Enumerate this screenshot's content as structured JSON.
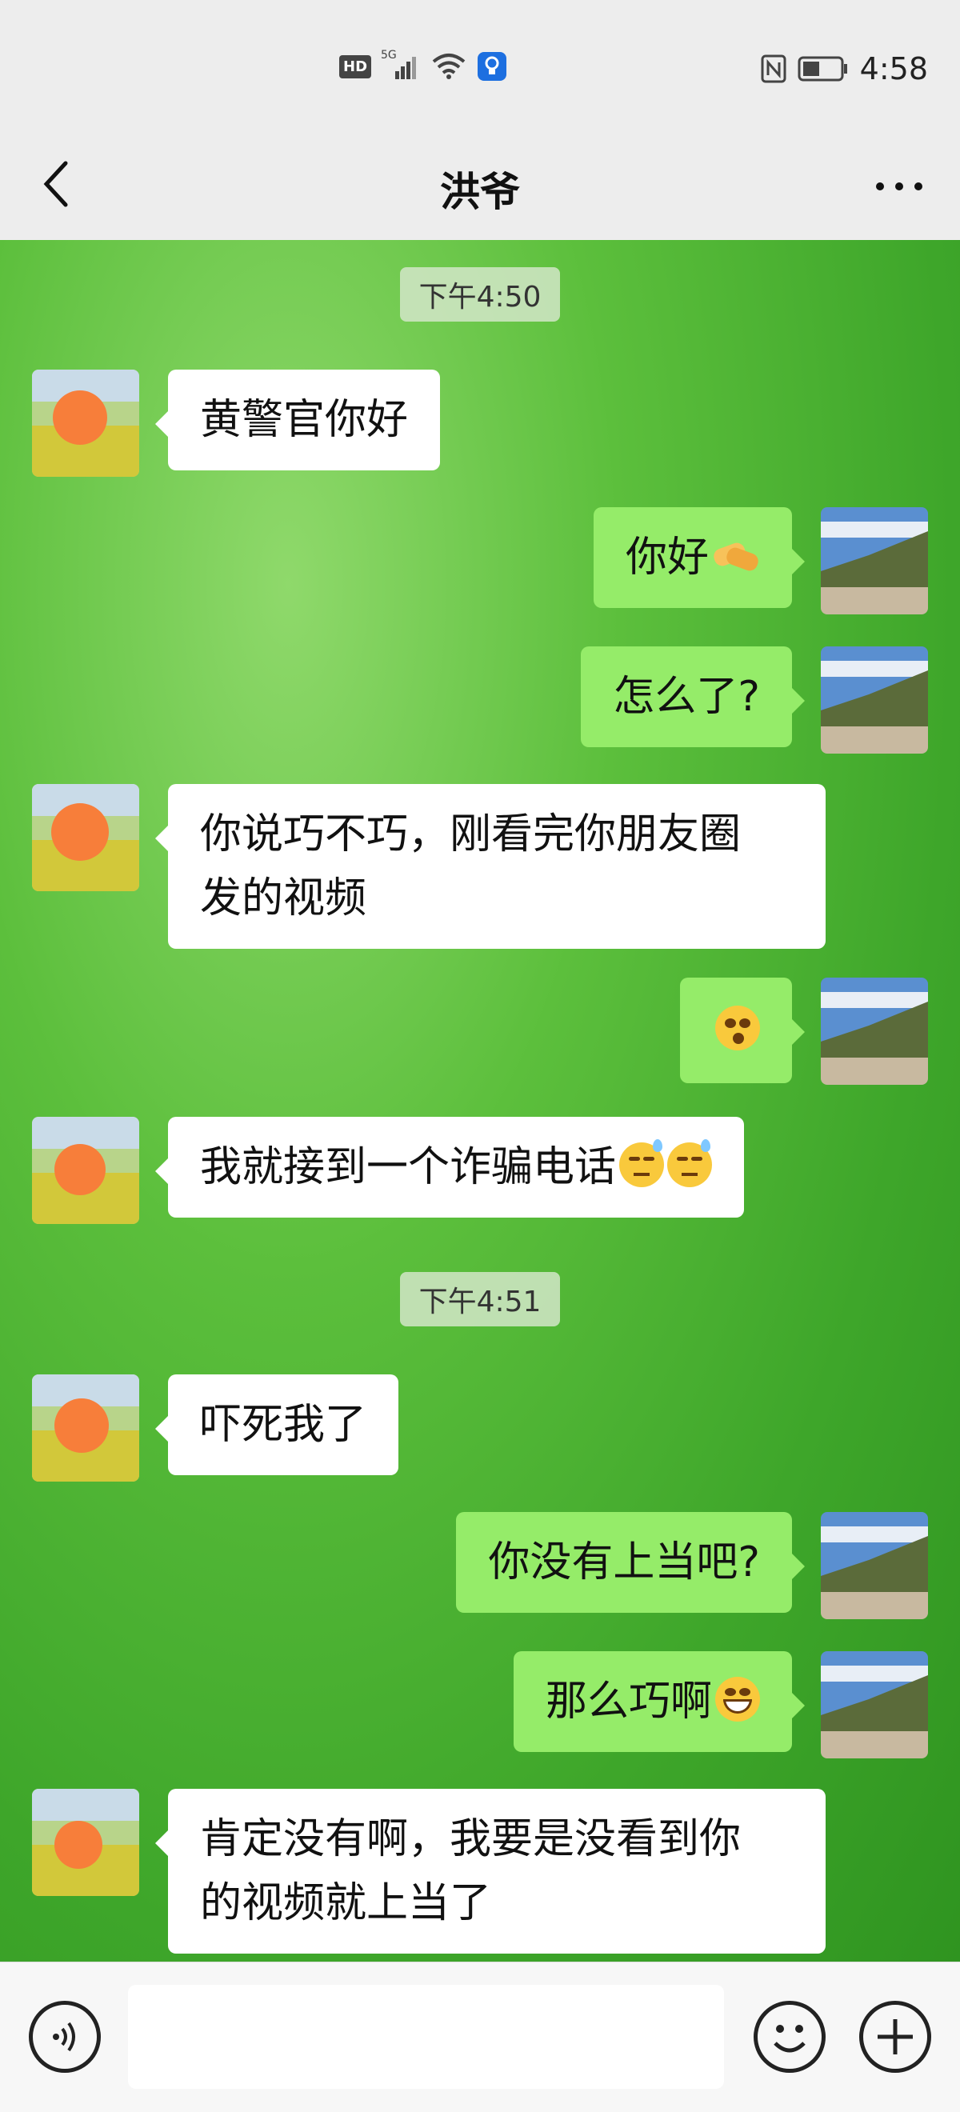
{
  "status_bar": {
    "hd_badge": "HD",
    "network": "5G",
    "time": "4:58"
  },
  "header": {
    "title": "洪爷",
    "back_icon": "chevron-left-icon",
    "more_icon": "more-dots-icon"
  },
  "messages": [
    {
      "type": "time",
      "text": "下午4:50"
    },
    {
      "type": "in",
      "text": "黄警官你好"
    },
    {
      "type": "out",
      "text": "你好",
      "emoji": "handshake"
    },
    {
      "type": "out",
      "text": "怎么了?"
    },
    {
      "type": "in",
      "text": "你说巧不巧，刚看完你朋友圈",
      "text2": "发的视频"
    },
    {
      "type": "out",
      "text": "",
      "emoji": "confused-face"
    },
    {
      "type": "in",
      "text": "我就接到一个诈骗电话",
      "emoji": "sweat-face x2"
    },
    {
      "type": "time",
      "text": "下午4:51"
    },
    {
      "type": "in",
      "text": "吓死我了"
    },
    {
      "type": "out",
      "text": "你没有上当吧?"
    },
    {
      "type": "out",
      "text": "那么巧啊",
      "emoji": "grin-face"
    },
    {
      "type": "in",
      "text": "肯定没有啊，我要是没看到你",
      "text2": "的视频就上当了"
    }
  ],
  "input_bar": {
    "placeholder": "",
    "voice_icon": "voice-icon",
    "emoji_icon": "emoji-icon",
    "plus_icon": "plus-icon"
  },
  "colors": {
    "incoming_bubble": "#ffffff",
    "outgoing_bubble": "#95ec69",
    "chat_background": "#4cb232"
  }
}
